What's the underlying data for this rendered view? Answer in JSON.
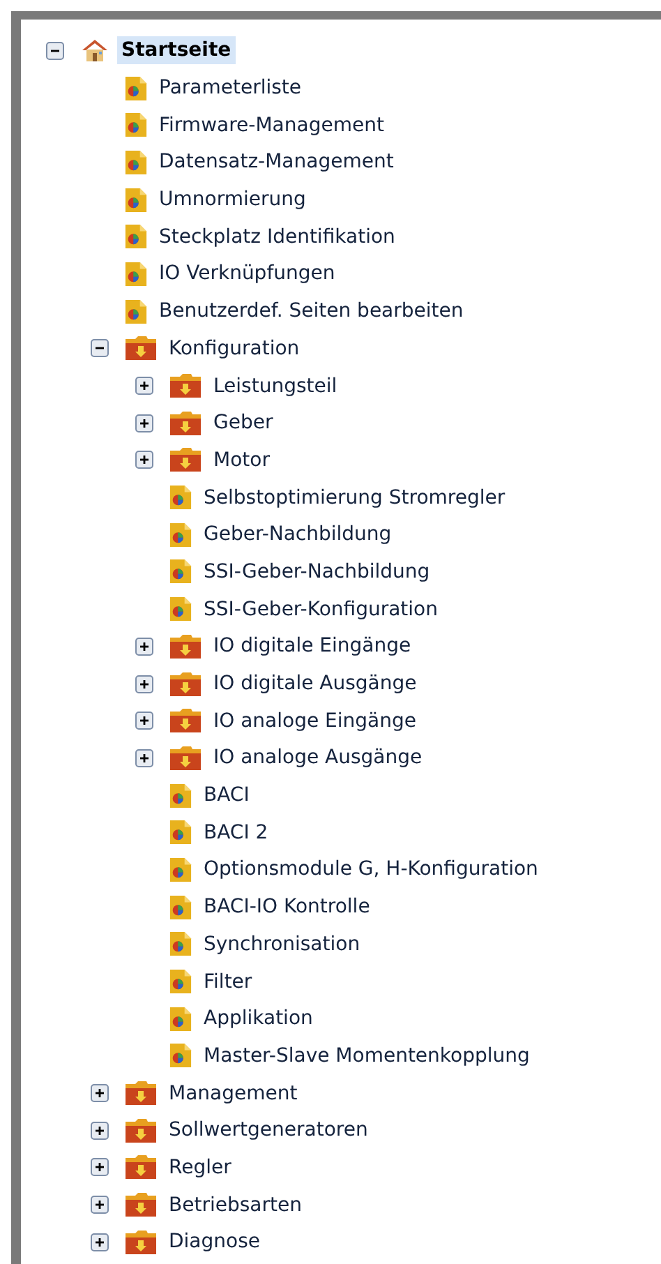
{
  "tree": [
    {
      "label": "Startseite",
      "kind": "home",
      "expanded": true,
      "selected": true,
      "children": [
        {
          "label": "Parameterliste",
          "kind": "page",
          "selected": false
        },
        {
          "label": "Firmware-Management",
          "kind": "page",
          "selected": false
        },
        {
          "label": "Datensatz-Management",
          "kind": "page",
          "selected": false
        },
        {
          "label": "Umnormierung",
          "kind": "page",
          "selected": false
        },
        {
          "label": "Steckplatz Identifikation",
          "kind": "page",
          "selected": false
        },
        {
          "label": "IO Verknüpfungen",
          "kind": "page",
          "selected": false
        },
        {
          "label": "Benutzerdef. Seiten bearbeiten",
          "kind": "page",
          "selected": false
        },
        {
          "label": "Konfiguration",
          "kind": "folder",
          "expanded": true,
          "selected": false,
          "children": [
            {
              "label": "Leistungsteil",
              "kind": "folder",
              "expanded": false,
              "selected": false
            },
            {
              "label": "Geber",
              "kind": "folder",
              "expanded": false,
              "selected": false
            },
            {
              "label": "Motor",
              "kind": "folder",
              "expanded": false,
              "selected": false
            },
            {
              "label": "Selbstoptimierung Stromregler",
              "kind": "page",
              "selected": false
            },
            {
              "label": "Geber-Nachbildung",
              "kind": "page",
              "selected": false
            },
            {
              "label": "SSI-Geber-Nachbildung",
              "kind": "page",
              "selected": false
            },
            {
              "label": "SSI-Geber-Konfiguration",
              "kind": "page",
              "selected": false
            },
            {
              "label": "IO digitale Eingänge",
              "kind": "folder",
              "expanded": false,
              "selected": false
            },
            {
              "label": "IO digitale Ausgänge",
              "kind": "folder",
              "expanded": false,
              "selected": false
            },
            {
              "label": "IO analoge Eingänge",
              "kind": "folder",
              "expanded": false,
              "selected": false
            },
            {
              "label": "IO analoge Ausgänge",
              "kind": "folder",
              "expanded": false,
              "selected": false
            },
            {
              "label": "BACI",
              "kind": "page",
              "selected": false
            },
            {
              "label": "BACI 2",
              "kind": "page",
              "selected": false
            },
            {
              "label": "Optionsmodule G, H-Konfiguration",
              "kind": "page",
              "selected": false
            },
            {
              "label": "BACI-IO Kontrolle",
              "kind": "page",
              "selected": false
            },
            {
              "label": "Synchronisation",
              "kind": "page",
              "selected": false
            },
            {
              "label": "Filter",
              "kind": "page",
              "selected": false
            },
            {
              "label": "Applikation",
              "kind": "page",
              "selected": false
            },
            {
              "label": "Master-Slave Momentenkopplung",
              "kind": "page",
              "selected": false
            }
          ]
        },
        {
          "label": "Management",
          "kind": "folder",
          "expanded": false,
          "selected": false
        },
        {
          "label": "Sollwertgeneratoren",
          "kind": "folder",
          "expanded": false,
          "selected": false
        },
        {
          "label": "Regler",
          "kind": "folder",
          "expanded": false,
          "selected": false
        },
        {
          "label": "Betriebsarten",
          "kind": "folder",
          "expanded": false,
          "selected": false
        },
        {
          "label": "Diagnose",
          "kind": "folder",
          "expanded": false,
          "selected": false
        }
      ]
    }
  ]
}
